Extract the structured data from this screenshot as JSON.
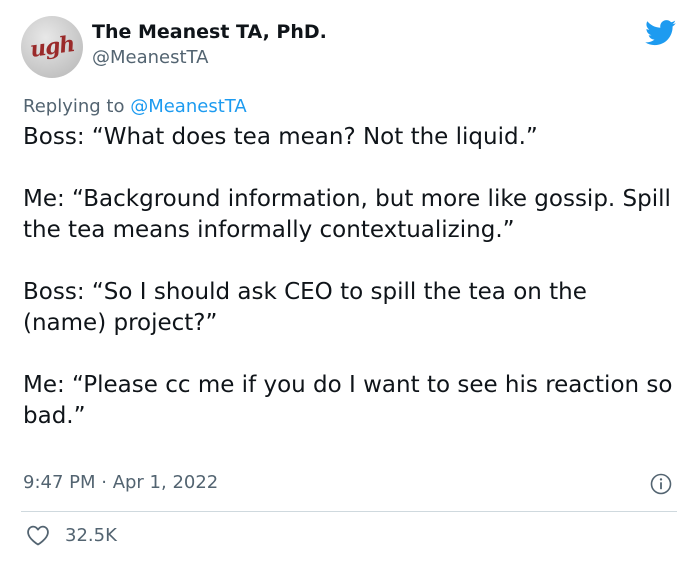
{
  "author": {
    "avatar_text": "ugh",
    "display_name": "The Meanest TA, PhD.",
    "handle": "@MeanestTA"
  },
  "reply": {
    "prefix": "Replying to ",
    "mention": "@MeanestTA"
  },
  "paragraphs": [
    "Boss: “What does tea mean? Not the liquid.”",
    "Me: “Background information, but more like gossip. Spill the tea means informally contextualizing.”",
    "Boss: “So I should ask CEO to spill the tea on the (name) project?”",
    "Me: “Please cc me if you do I want to see his reaction so bad.”"
  ],
  "timestamp": "9:47 PM · Apr 1, 2022",
  "stats": {
    "likes": "32.5K"
  },
  "icons": {
    "brand": "twitter-bird-icon",
    "info": "info-icon",
    "like": "heart-icon"
  },
  "colors": {
    "brand_blue": "#1d9bf0",
    "text": "#0f1419",
    "secondary": "#536471",
    "divider": "#cfd9de"
  }
}
